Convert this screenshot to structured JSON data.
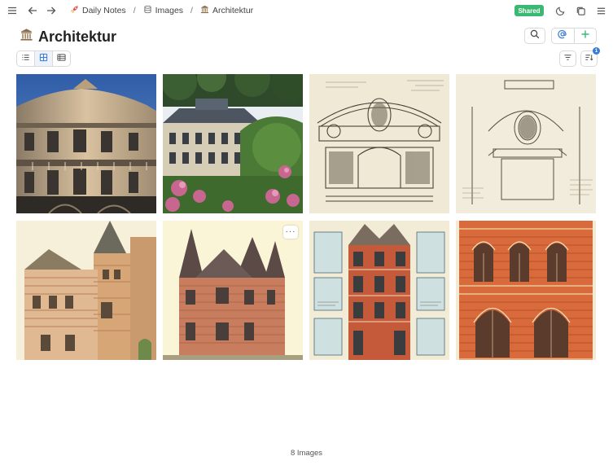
{
  "topbar": {
    "menu_icon": "hamburger-icon",
    "back_icon": "arrow-left-icon",
    "forward_icon": "arrow-right-icon",
    "breadcrumbs": [
      {
        "label": "Daily Notes",
        "icon": "rocket-icon"
      },
      {
        "label": "Images",
        "icon": "database-icon"
      },
      {
        "label": "Architektur",
        "icon": "classical-building-icon"
      }
    ],
    "separator": "/",
    "shared_label": "Shared",
    "theme_icon": "moon-icon",
    "copy_icon": "duplicate-icon",
    "more_icon": "hamburger-icon"
  },
  "page": {
    "title": "Architektur",
    "title_icon": "classical-building-icon"
  },
  "toolbar": {
    "search_icon": "search-icon",
    "mention_icon": "at-sign-icon",
    "add_icon": "plus-icon",
    "views": [
      {
        "icon": "list-view-icon",
        "active": false
      },
      {
        "icon": "gallery-view-icon",
        "active": true
      },
      {
        "icon": "table-view-icon",
        "active": false
      }
    ],
    "filter_icon": "filter-icon",
    "sort_icon": "sort-icon",
    "sort_badge": "1"
  },
  "gallery": {
    "images": [
      {
        "subject": "baroque-corner-building-photo"
      },
      {
        "subject": "chateau-with-rhododendrons-photo"
      },
      {
        "subject": "ornate-window-engraving"
      },
      {
        "subject": "oval-window-pediment-drawing"
      },
      {
        "subject": "brick-villa-elevation"
      },
      {
        "subject": "gothic-revival-house-elevation",
        "hovered": true
      },
      {
        "subject": "townhouse-facade-with-plans"
      },
      {
        "subject": "red-brick-arched-facade"
      }
    ],
    "hover_menu_label": "···"
  },
  "footer": {
    "count_label": "8 Images"
  },
  "colors": {
    "shared_badge": "#3bb973",
    "accent_blue": "#3a7bd5"
  }
}
